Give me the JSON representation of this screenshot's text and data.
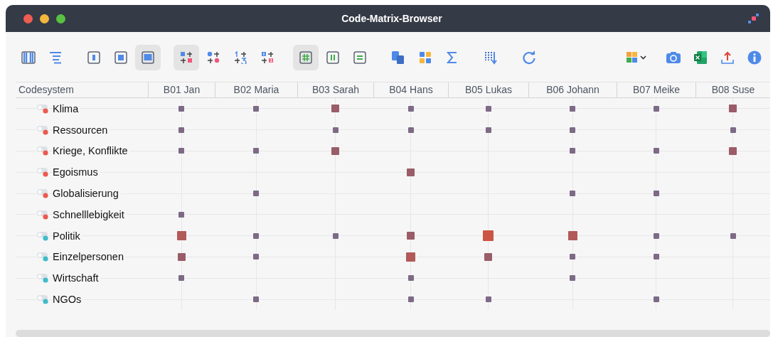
{
  "window": {
    "title": "Code-Matrix-Browser"
  },
  "toolbar_groups": [
    [
      {
        "kind": "columns",
        "selected": false
      },
      {
        "kind": "tree",
        "selected": false
      }
    ],
    [
      {
        "kind": "frame-narrow",
        "selected": false
      },
      {
        "kind": "frame-square",
        "selected": false
      },
      {
        "kind": "frame-wide",
        "selected": true
      }
    ],
    [
      {
        "kind": "symbol-square",
        "selected": true
      },
      {
        "kind": "symbol-circle",
        "selected": false
      },
      {
        "kind": "symbol-number",
        "selected": false
      },
      {
        "kind": "symbol-boxnumber",
        "selected": false
      }
    ],
    [
      {
        "kind": "grid-hash",
        "selected": true
      },
      {
        "kind": "grid-columns",
        "selected": false
      },
      {
        "kind": "grid-rows",
        "selected": false
      }
    ],
    [
      {
        "kind": "docs",
        "selected": false
      },
      {
        "kind": "tiles",
        "selected": false
      },
      {
        "kind": "sum",
        "selected": false
      }
    ],
    [
      {
        "kind": "sort",
        "selected": false
      }
    ],
    [
      {
        "kind": "refresh",
        "selected": false
      }
    ]
  ],
  "toolbar_right": [
    {
      "kind": "puzzle",
      "selected": false
    },
    {
      "kind": "camera",
      "selected": false
    },
    {
      "kind": "excel",
      "selected": false
    },
    {
      "kind": "export",
      "selected": false
    },
    {
      "kind": "info",
      "selected": false
    }
  ],
  "table": {
    "columns": [
      "Codesystem",
      "B01 Jan",
      "B02 Maria",
      "B03 Sarah",
      "B04 Hans",
      "B05 Lukas",
      "B06 Johann",
      "B07 Meike",
      "B08 Suse"
    ],
    "rows": [
      {
        "code": "Klima",
        "color": "#ec5a4f",
        "cells": [
          {
            "kind": "small"
          },
          {
            "kind": "small"
          },
          {
            "kind": "medium"
          },
          {
            "kind": "small"
          },
          {
            "kind": "small"
          },
          {
            "kind": "small"
          },
          {
            "kind": "small"
          },
          {
            "kind": "medium"
          }
        ]
      },
      {
        "code": "Ressourcen",
        "color": "#ec5a4f",
        "cells": [
          {
            "kind": "small"
          },
          {
            "kind": "none"
          },
          {
            "kind": "small"
          },
          {
            "kind": "small"
          },
          {
            "kind": "small"
          },
          {
            "kind": "small"
          },
          {
            "kind": "none"
          },
          {
            "kind": "small"
          }
        ]
      },
      {
        "code": "Kriege, Konflikte",
        "color": "#ec5a4f",
        "cells": [
          {
            "kind": "small"
          },
          {
            "kind": "small"
          },
          {
            "kind": "medium"
          },
          {
            "kind": "none"
          },
          {
            "kind": "none"
          },
          {
            "kind": "small"
          },
          {
            "kind": "small"
          },
          {
            "kind": "medium"
          }
        ]
      },
      {
        "code": "Egoismus",
        "color": "#ec5a4f",
        "cells": [
          {
            "kind": "none"
          },
          {
            "kind": "none"
          },
          {
            "kind": "none"
          },
          {
            "kind": "medium"
          },
          {
            "kind": "none"
          },
          {
            "kind": "none"
          },
          {
            "kind": "none"
          },
          {
            "kind": "none"
          }
        ]
      },
      {
        "code": "Globalisierung",
        "color": "#ec5a4f",
        "cells": [
          {
            "kind": "none"
          },
          {
            "kind": "small"
          },
          {
            "kind": "none"
          },
          {
            "kind": "none"
          },
          {
            "kind": "none"
          },
          {
            "kind": "small"
          },
          {
            "kind": "small"
          },
          {
            "kind": "none"
          }
        ]
      },
      {
        "code": "Schnelllebigkeit",
        "color": "#ec5a4f",
        "cells": [
          {
            "kind": "small"
          },
          {
            "kind": "none"
          },
          {
            "kind": "none"
          },
          {
            "kind": "none"
          },
          {
            "kind": "none"
          },
          {
            "kind": "none"
          },
          {
            "kind": "none"
          },
          {
            "kind": "none"
          }
        ]
      },
      {
        "code": "Politik",
        "color": "#3fbccb",
        "cells": [
          {
            "kind": "large"
          },
          {
            "kind": "small"
          },
          {
            "kind": "small"
          },
          {
            "kind": "medium"
          },
          {
            "kind": "xlarge"
          },
          {
            "kind": "large"
          },
          {
            "kind": "small"
          },
          {
            "kind": "small"
          }
        ]
      },
      {
        "code": "Einzelpersonen",
        "color": "#3fbccb",
        "cells": [
          {
            "kind": "medium"
          },
          {
            "kind": "small"
          },
          {
            "kind": "none"
          },
          {
            "kind": "large"
          },
          {
            "kind": "medium"
          },
          {
            "kind": "small"
          },
          {
            "kind": "small"
          },
          {
            "kind": "none"
          }
        ]
      },
      {
        "code": "Wirtschaft",
        "color": "#3fbccb",
        "cells": [
          {
            "kind": "small"
          },
          {
            "kind": "none"
          },
          {
            "kind": "none"
          },
          {
            "kind": "small"
          },
          {
            "kind": "none"
          },
          {
            "kind": "small"
          },
          {
            "kind": "none"
          },
          {
            "kind": "none"
          }
        ]
      },
      {
        "code": "NGOs",
        "color": "#3fbccb",
        "cells": [
          {
            "kind": "none"
          },
          {
            "kind": "small"
          },
          {
            "kind": "none"
          },
          {
            "kind": "small"
          },
          {
            "kind": "small"
          },
          {
            "kind": "none"
          },
          {
            "kind": "small"
          },
          {
            "kind": "none"
          }
        ]
      }
    ]
  }
}
